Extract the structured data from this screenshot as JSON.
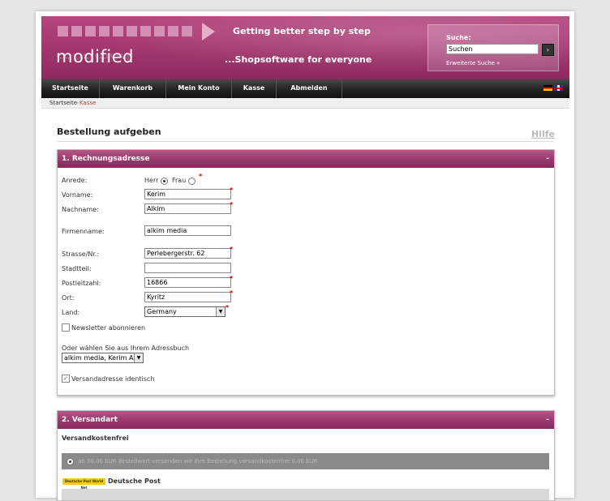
{
  "header": {
    "logo": "modified",
    "tagline1": "Getting better step by step",
    "tagline2": "...Shopsoftware for everyone",
    "search_label": "Suche:",
    "search_value": "Suchen",
    "search_go": "›",
    "advanced_search": "Erweiterte Suche »"
  },
  "nav": {
    "items": [
      "Startseite",
      "Warenkorb",
      "Mein Konto",
      "Kasse",
      "Abmelden"
    ]
  },
  "breadcrumb": {
    "home": "Startseite",
    "separator": "»",
    "current": "Kasse"
  },
  "page": {
    "title": "Bestellung aufgeben",
    "help": "Hilfe"
  },
  "billing": {
    "heading": "1. Rechnungsadresse",
    "toggle": "-",
    "labels": {
      "salutation": "Anrede:",
      "firstname": "Vorname:",
      "lastname": "Nachname:",
      "company": "Firmenname:",
      "street": "Strasse/Nr.:",
      "district": "Stadtteil:",
      "zip": "Postleitzahl:",
      "city": "Ort:",
      "country": "Land:"
    },
    "salutation_options": [
      "Herr",
      "Frau"
    ],
    "salutation_selected": "Herr",
    "values": {
      "firstname": "Kerim",
      "lastname": "Alkim",
      "company": "alkim media",
      "street": "Perlebergerstr. 62",
      "district": "",
      "zip": "16866",
      "city": "Kyritz",
      "country": "Germany"
    },
    "required_mark": "*",
    "newsletter_label": "Newsletter abonnieren",
    "newsletter_checked": false,
    "addressbook_label": "Oder wählen Sie aus Ihrem Adressbuch",
    "addressbook_value": "alkim media, Kerim Alkim",
    "same_shipping_label": "Versandadresse identisch",
    "same_shipping_checked": true
  },
  "shipping": {
    "heading": "2. Versandart",
    "toggle": "-",
    "method1_title": "Versandkostenfrei",
    "method1_text": "ab 50,00 EUR Bestellwert versenden wir Ihre Bestellung versandkostenfrei 0,00 EUR",
    "method2_logo": "Deutsche Post  World Net",
    "method2_title": "Deutsche Post"
  },
  "colors": {
    "brand": "#a53870",
    "nav": "#262626",
    "required": "#cc0000",
    "breadcrumb_current": "#c0392b"
  }
}
